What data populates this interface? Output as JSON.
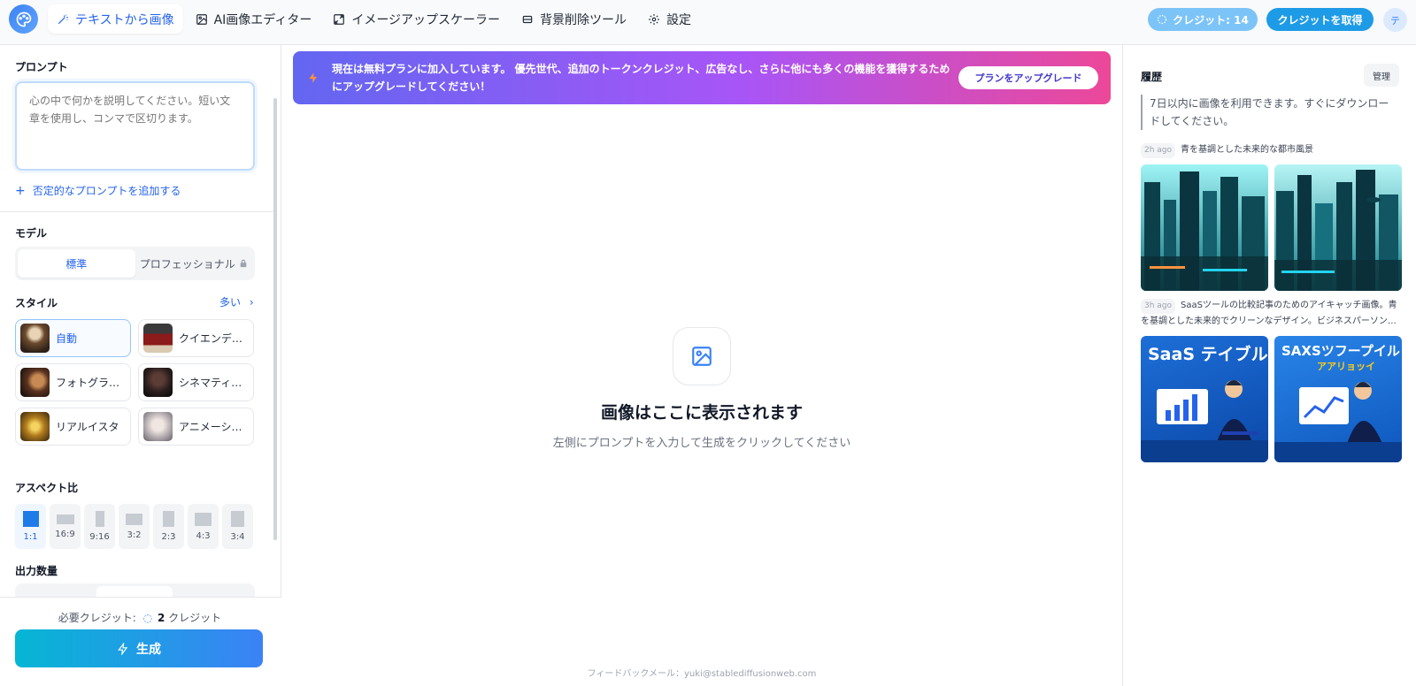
{
  "nav": {
    "items": [
      {
        "label": "テキストから画像",
        "icon": "magic-wand-icon",
        "active": true
      },
      {
        "label": "AI画像エディター",
        "icon": "image-icon",
        "active": false
      },
      {
        "label": "イメージアップスケーラー",
        "icon": "expand-icon",
        "active": false
      },
      {
        "label": "背景削除ツール",
        "icon": "eraser-icon",
        "active": false
      },
      {
        "label": "設定",
        "icon": "gear-icon",
        "active": false
      }
    ],
    "credits_label": "クレジット: 14",
    "get_credits_label": "クレジットを取得",
    "avatar_initial": "テ"
  },
  "sidebar": {
    "prompt_label": "プロンプト",
    "prompt_placeholder": "心の中で何かを説明してください。短い文章を使用し、コンマで区切ります。",
    "negative_prompt_link": "否定的なプロンプトを追加する",
    "model_label": "モデル",
    "models": [
      {
        "label": "標準",
        "active": true
      },
      {
        "label": "プロフェッショナル",
        "active": false,
        "locked": true
      }
    ],
    "style_label": "スタイル",
    "style_more": "多い",
    "styles": [
      {
        "label": "自動",
        "active": true
      },
      {
        "label": "クイエンデザ…",
        "active": false
      },
      {
        "label": "フォトグラフ…",
        "active": false
      },
      {
        "label": "シネマティック",
        "active": false
      },
      {
        "label": "リアルイスタ",
        "active": false
      },
      {
        "label": "アニメーション",
        "active": false
      }
    ],
    "aspect_label": "アスペクト比",
    "aspects": [
      {
        "label": "1:1",
        "active": true
      },
      {
        "label": "16:9",
        "active": false
      },
      {
        "label": "9:16",
        "active": false
      },
      {
        "label": "3:2",
        "active": false
      },
      {
        "label": "2:3",
        "active": false
      },
      {
        "label": "4:3",
        "active": false
      },
      {
        "label": "3:4",
        "active": false
      }
    ],
    "output_count_label": "出力数量",
    "required_credits_prefix": "必要クレジット:",
    "required_credits_value": "2",
    "required_credits_unit": "クレジット",
    "generate_label": "生成"
  },
  "banner": {
    "text": "現在は無料プランに加入しています。 優先世代、追加のトークンクレジット、広告なし、さらに他にも多くの機能を獲得するためにアップグレードしてください！",
    "upgrade_label": "プランをアップグレード"
  },
  "main": {
    "placeholder_title": "画像はここに表示されます",
    "placeholder_subtitle": "左側にプロンプトを入力して生成をクリックしてください",
    "feedback": "フィードバックメール：yuki@stablediffusionweb.com"
  },
  "history": {
    "title": "履歴",
    "manage_label": "管理",
    "note": "7日以内に画像を利用できます。すぐにダウンロードしてください。",
    "entries": [
      {
        "ago": "2h ago",
        "prompt": "青を基調とした未来的な都市風景"
      },
      {
        "ago": "3h ago",
        "prompt": "SaaSツールの比較記事のためのアイキャッチ画像。青を基調とした未来的でクリーンなデザイン。ビジネスパーソン…"
      }
    ],
    "image_texts": [
      "SaaS テイブル",
      "SAXSツフープイル",
      "アアリョッイ"
    ]
  },
  "colors": {
    "accent": "#2563eb",
    "banner_start": "#6366f1",
    "banner_end": "#ec4899",
    "generate_start": "#06b6d4",
    "generate_end": "#3b82f6"
  }
}
